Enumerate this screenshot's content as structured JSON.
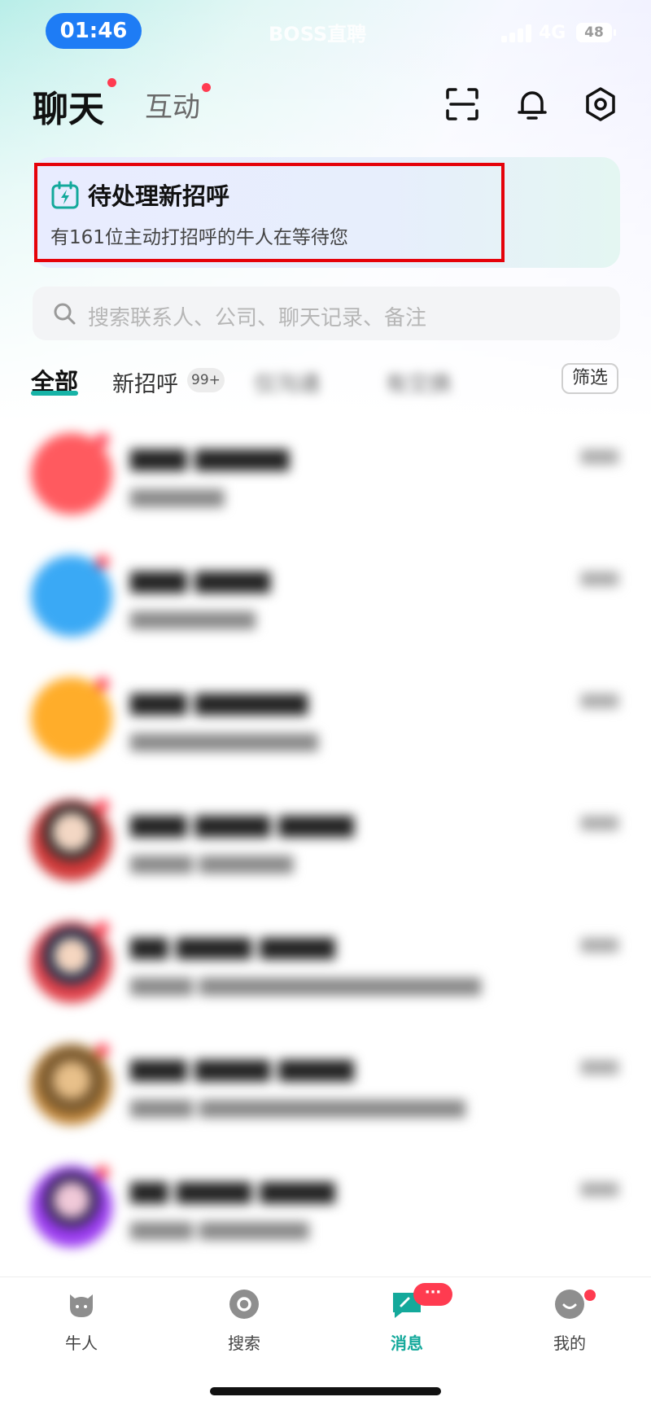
{
  "status_bar": {
    "time": "01:46",
    "carrier": "BOSS直聘",
    "network": "4G",
    "battery": "48"
  },
  "header": {
    "tab_chat": "聊天",
    "tab_interaction": "互动"
  },
  "banner": {
    "title": "待处理新招呼",
    "subtitle": "有161位主动打招呼的牛人在等待您"
  },
  "search": {
    "placeholder": "搜索联系人、公司、聊天记录、备注"
  },
  "filters": {
    "all": "全部",
    "new_greetings": "新招呼",
    "new_greetings_badge": "99+",
    "blurred_1": "仅沟通",
    "blurred_2": "有交换",
    "filter_button": "筛选"
  },
  "colors": {
    "accent": "#14a99b",
    "alert": "#ff3b50",
    "highlight_border": "#e5020a"
  },
  "bottom_nav": {
    "items": [
      {
        "label": "牛人",
        "icon": "cat-face-icon"
      },
      {
        "label": "搜索",
        "icon": "search-disc-icon"
      },
      {
        "label": "消息",
        "icon": "chat-bubble-icon"
      },
      {
        "label": "我的",
        "icon": "smile-face-icon"
      }
    ],
    "message_badge": "···"
  }
}
